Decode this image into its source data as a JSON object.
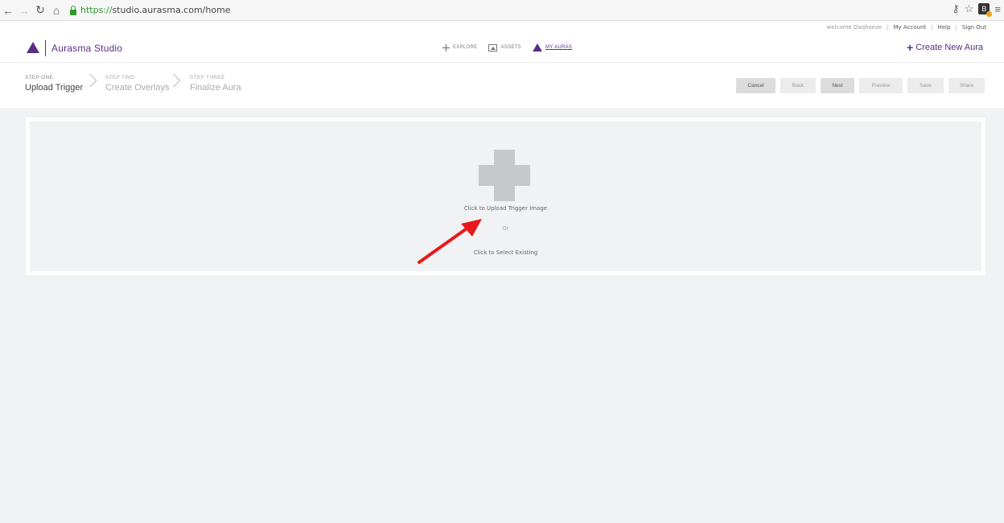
{
  "browser": {
    "url_proto": "https://",
    "url_rest": "studio.aurasma.com/home",
    "ext_badge": "B"
  },
  "userbar": {
    "welcome": "welcome Daqhoeze",
    "my_account": "My Account",
    "help": "Help",
    "sign_out": "Sign Out",
    "sep": "|"
  },
  "header": {
    "app_name": "Aurasma Studio",
    "nav": [
      {
        "label": "EXPLORE"
      },
      {
        "label": "ASSETS"
      },
      {
        "label": "MY AURAS"
      }
    ],
    "create_new": "Create New Aura"
  },
  "steps": [
    {
      "label": "STEP ONE",
      "name": "Upload Trigger"
    },
    {
      "label": "STEP TWO",
      "name": "Create Overlays"
    },
    {
      "label": "STEP THREE",
      "name": "Finalize Aura"
    }
  ],
  "actions": {
    "cancel": "Cancel",
    "back": "Back",
    "next": "Next",
    "preview": "Preview",
    "save": "Save",
    "share": "Share"
  },
  "upload": {
    "upload_label": "Click to Upload Trigger Image",
    "or_label": "Or",
    "select_label": "Click to Select Existing"
  },
  "colors": {
    "brand": "#5b2d86",
    "annotation": "#e8191c"
  }
}
